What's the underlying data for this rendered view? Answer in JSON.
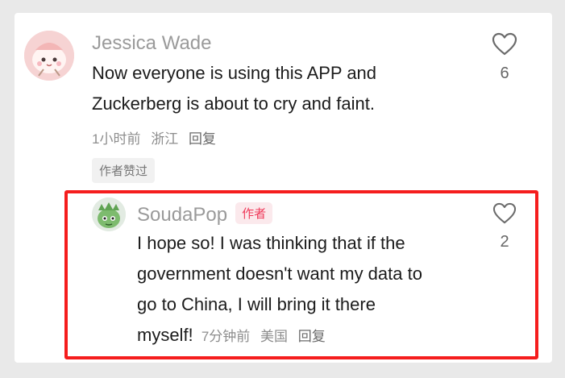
{
  "comments": [
    {
      "username": "Jessica Wade",
      "lines": [
        "Now everyone is using this APP and",
        "Zuckerberg is about to cry and faint."
      ],
      "time": "1小时前",
      "location": "浙江",
      "reply_label": "回复",
      "like_count": "6",
      "author_liked_tag": "作者赞过",
      "avatar_icon": "pink-cartoon-avatar-icon"
    },
    {
      "username": "SoudaPop",
      "author_badge": "作者",
      "lines": [
        "I hope so! I was thinking that if the",
        "government doesn't want my data to",
        "go to China, I will bring it there",
        "myself!"
      ],
      "time": "7分钟前",
      "location": "美国",
      "reply_label": "回复",
      "like_count": "2",
      "avatar_icon": "green-creature-avatar-icon"
    }
  ],
  "colors": {
    "highlight_border": "#f51d1d",
    "author_badge_text": "#ef3a5a",
    "author_badge_bg": "#fbe9ec"
  }
}
